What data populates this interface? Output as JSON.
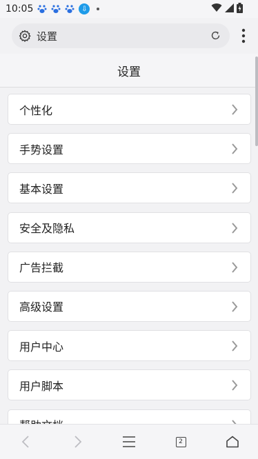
{
  "status_bar": {
    "time": "10:05"
  },
  "address_bar": {
    "text": "设置"
  },
  "header": {
    "title": "设置"
  },
  "settings": {
    "items": [
      {
        "label": "个性化"
      },
      {
        "label": "手势设置"
      },
      {
        "label": "基本设置"
      },
      {
        "label": "安全及隐私"
      },
      {
        "label": "广告拦截"
      },
      {
        "label": "高级设置"
      },
      {
        "label": "用户中心"
      },
      {
        "label": "用户脚本"
      },
      {
        "label": "帮助文档"
      }
    ]
  },
  "bottom_nav": {
    "tab_count": "2"
  },
  "colors": {
    "background": "#f2f2f4",
    "card": "#ffffff",
    "accent_blue": "#1e9be9"
  }
}
